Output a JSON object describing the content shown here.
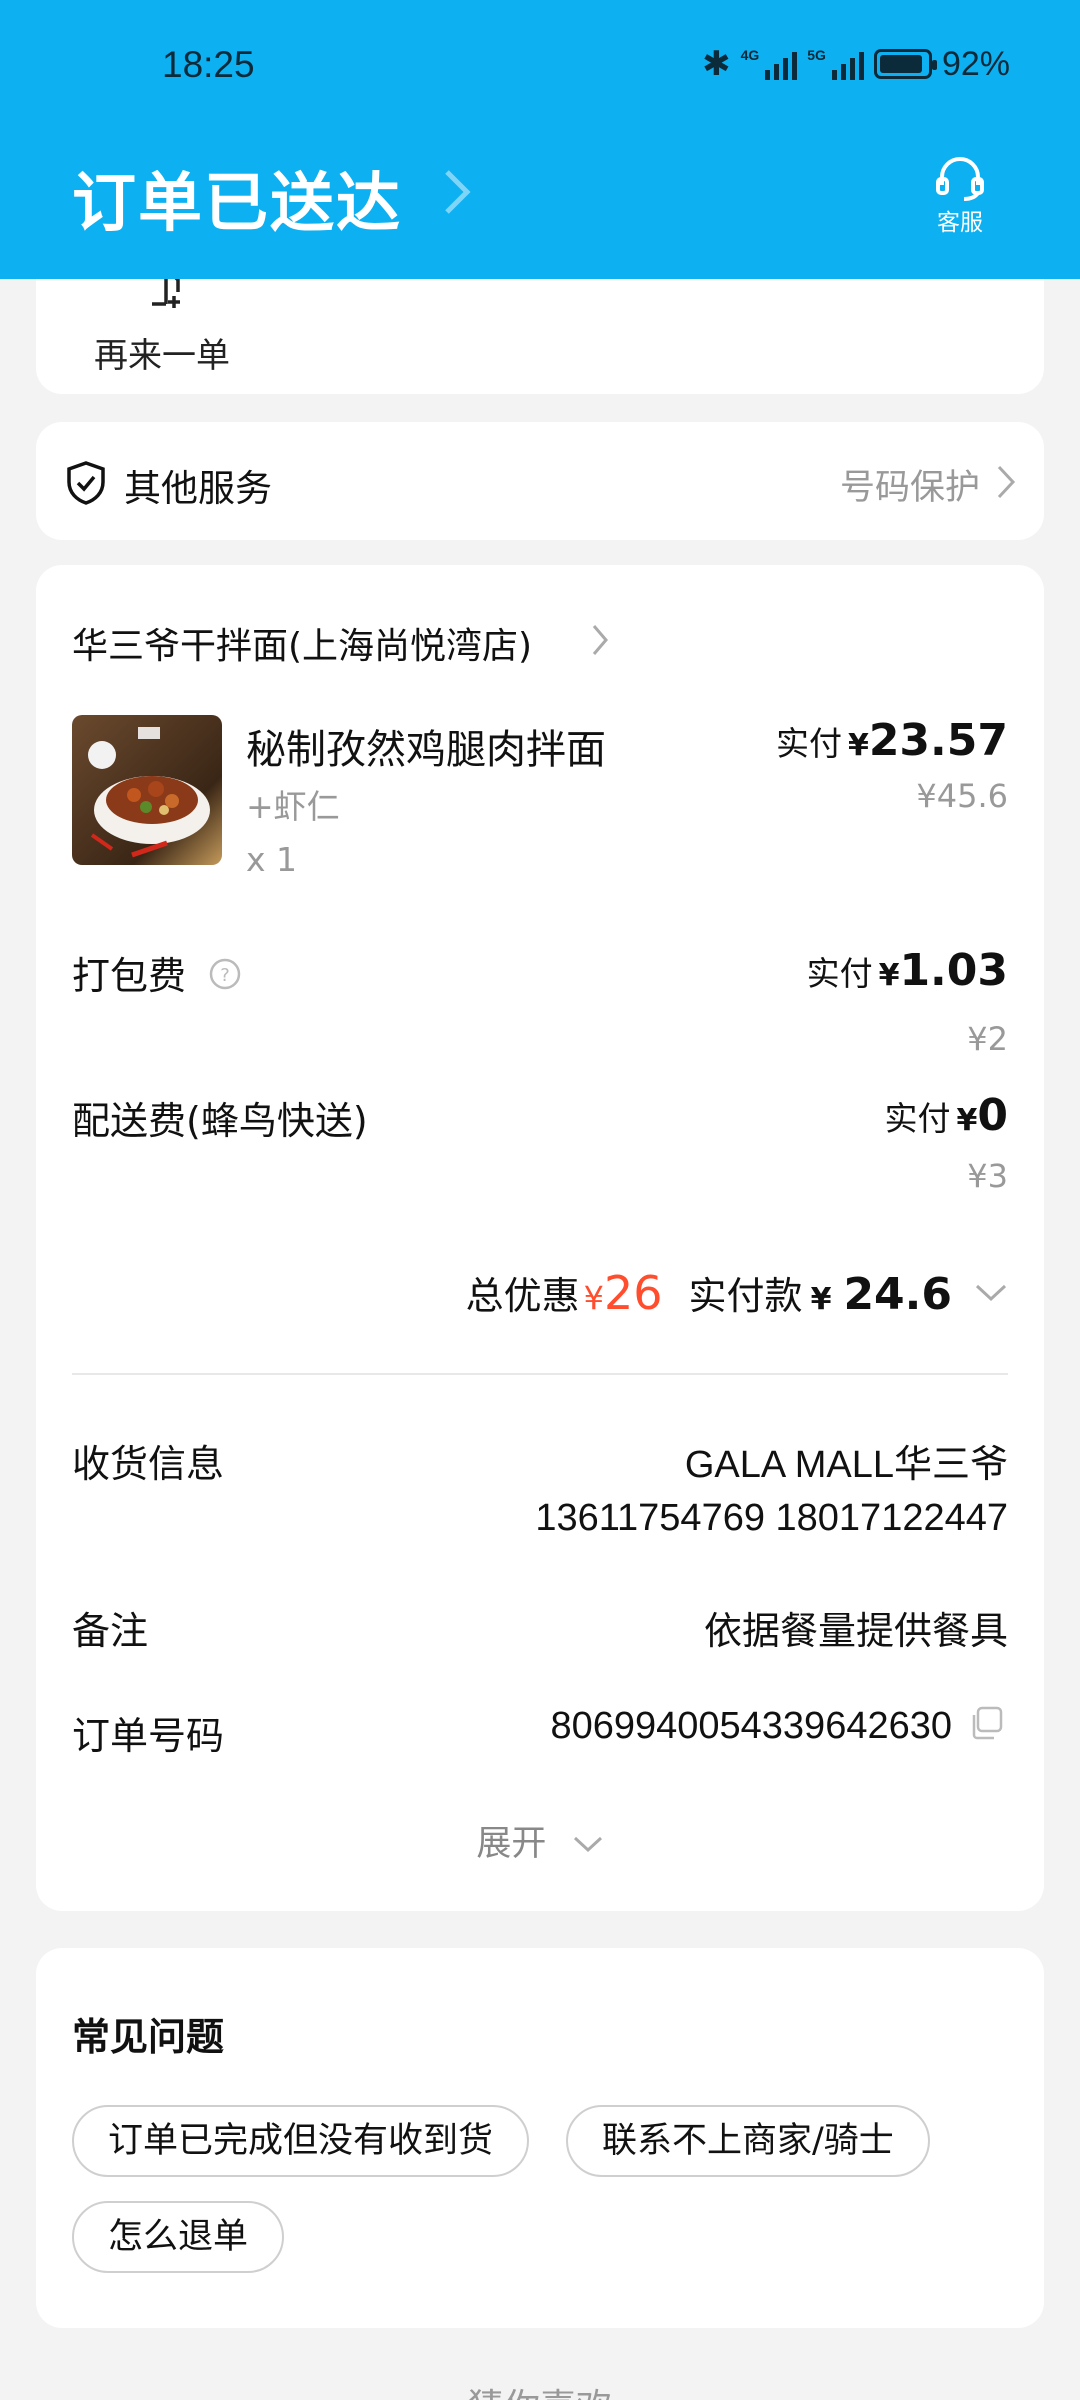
{
  "status_bar": {
    "time": "18:25",
    "battery": "92%",
    "net1": "4G",
    "net2": "5G"
  },
  "header": {
    "title": "订单已送达",
    "service_label": "客服"
  },
  "actions": {
    "reorder_label": "再来一单"
  },
  "other_services": {
    "label": "其他服务",
    "value": "号码保护"
  },
  "order": {
    "shop_name": "华三爷干拌面(上海尚悦湾店)",
    "item": {
      "name": "秘制孜然鸡腿肉拌面",
      "option": "+虾仁",
      "qty": "x 1",
      "paid_label": "实付",
      "currency": "¥",
      "paid": "23.57",
      "original": "¥45.6"
    },
    "packing": {
      "label": "打包费",
      "paid_label": "实付",
      "currency": "¥",
      "paid": "1.03",
      "original": "¥2"
    },
    "delivery": {
      "label": "配送费(蜂鸟快送)",
      "paid_label": "实付",
      "currency": "¥",
      "paid": "0",
      "original": "¥3"
    },
    "summary": {
      "discount_label": "总优惠",
      "discount_currency": "¥",
      "discount": "26",
      "paid_label": "实付款",
      "currency": "¥",
      "paid": "24.6"
    },
    "info": {
      "receiver_label": "收货信息",
      "receiver_name": "GALA MALL华三爷",
      "receiver_phones": "13611754769 18017122447",
      "note_label": "备注",
      "note_value": "依据餐量提供餐具",
      "order_no_label": "订单号码",
      "order_no": "8069940054339642630",
      "expand_label": "展开"
    }
  },
  "faq": {
    "title": "常见问题",
    "chips": [
      "订单已完成但没有收到货",
      "联系不上商家/骑士",
      "怎么退单"
    ]
  },
  "footer": {
    "guess_label": "猜你喜欢"
  },
  "colors": {
    "header_bg": "#0db0f0",
    "discount_red": "#ff4d2d"
  }
}
